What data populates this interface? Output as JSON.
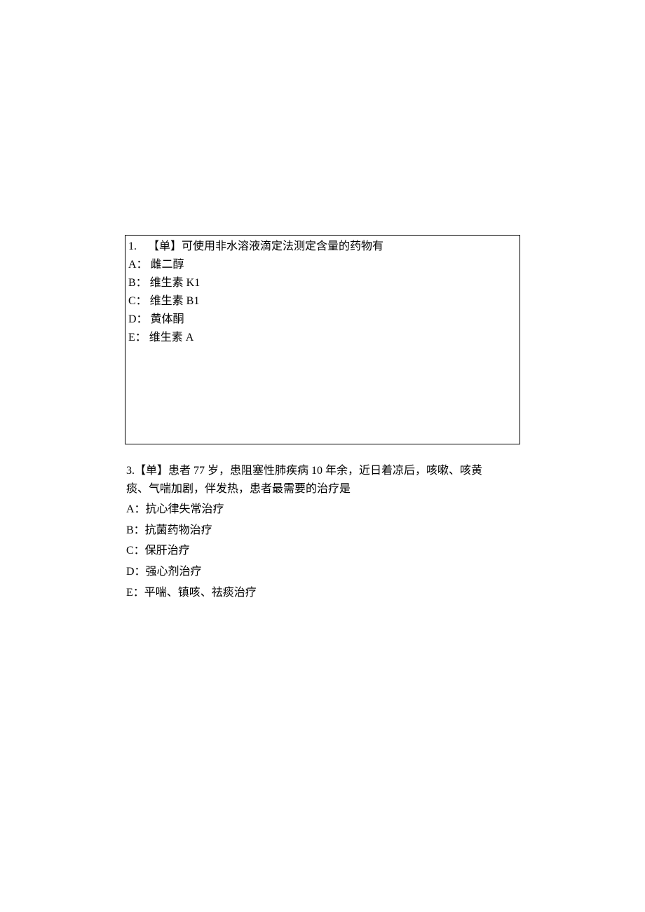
{
  "q1": {
    "number": "1.",
    "type": "【单】",
    "stem": "可使用非水溶液滴定法测定含量的药物有",
    "options": {
      "a": "A： 雌二醇",
      "b": "B： 维生素 K1",
      "c": "C： 维生素 B1",
      "d": "D： 黄体酮",
      "e": "E： 维生素 A"
    }
  },
  "q3": {
    "stem_line1": "3.【单】患者 77 岁，患阻塞性肺疾病 10 年余，近日着凉后，咳嗽、咳黄",
    "stem_line2": "痰、气喘加剧，伴发热，患者最需要的治疗是",
    "options": {
      "a": "A：抗心律失常治疗",
      "b": "B：抗菌药物治疗",
      "c": "C：保肝治疗",
      "d": "D：强心剂治疗",
      "e": "E：平喘、镇咳、祛痰治疗"
    }
  }
}
